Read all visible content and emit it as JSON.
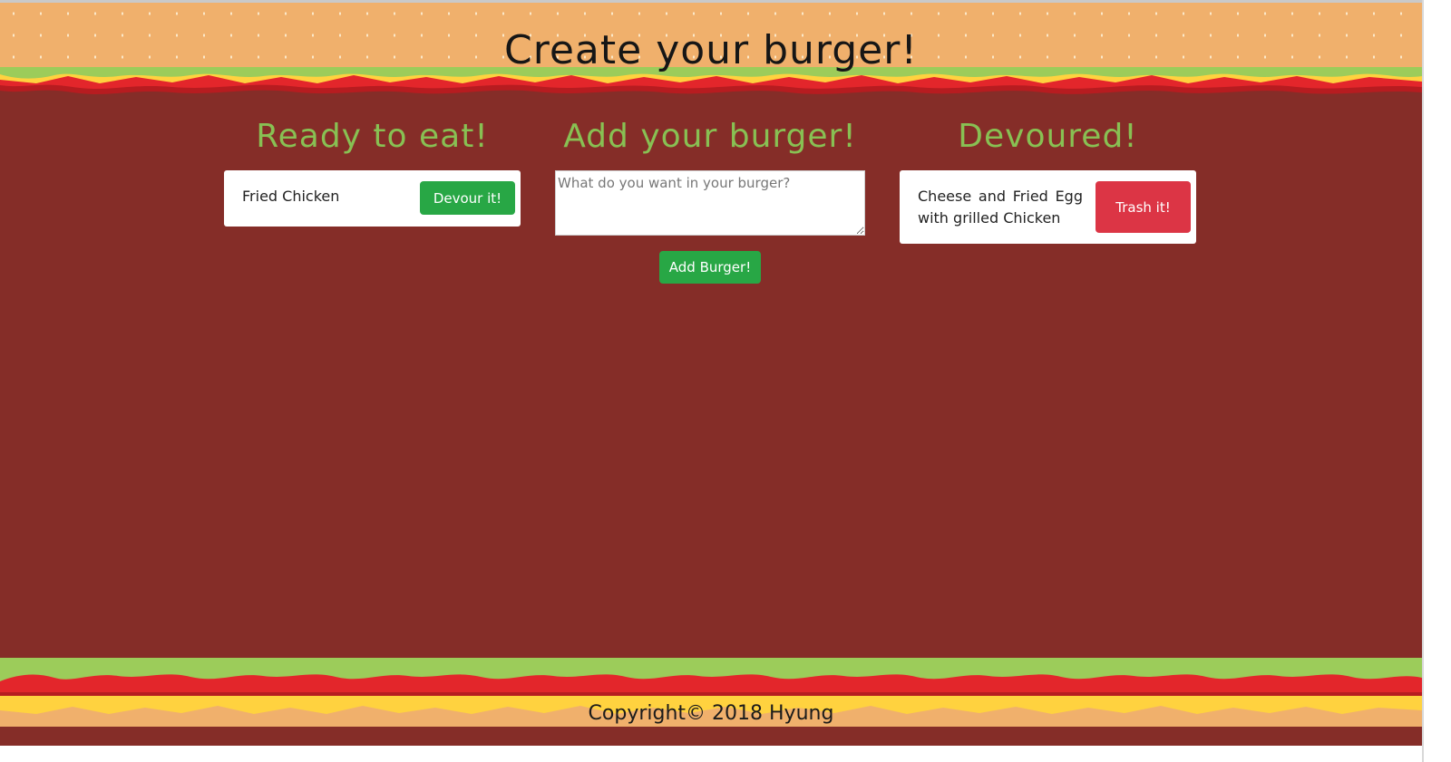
{
  "header": {
    "title": "Create your burger!"
  },
  "ready_column": {
    "heading": "Ready to eat!",
    "items": [
      {
        "name": "Fried Chicken",
        "action": "Devour it!"
      }
    ]
  },
  "add_column": {
    "heading": "Add your burger!",
    "placeholder": "What do you want in your burger?",
    "submit_label": "Add Burger!"
  },
  "devoured_column": {
    "heading": "Devoured!",
    "items": [
      {
        "name": "Cheese and Fried Egg with grilled Chicken",
        "action": "Trash it!"
      }
    ]
  },
  "footer": {
    "copyright": "Copyright© 2018 Hyung"
  },
  "colors": {
    "bun": "#f0b06c",
    "lettuce": "#9ccc5a",
    "cheese": "#ffd23f",
    "tomato": "#d7262b",
    "patty": "#852d28",
    "heading_green": "#88c053",
    "button_green": "#28a745",
    "button_red": "#dc3545"
  }
}
